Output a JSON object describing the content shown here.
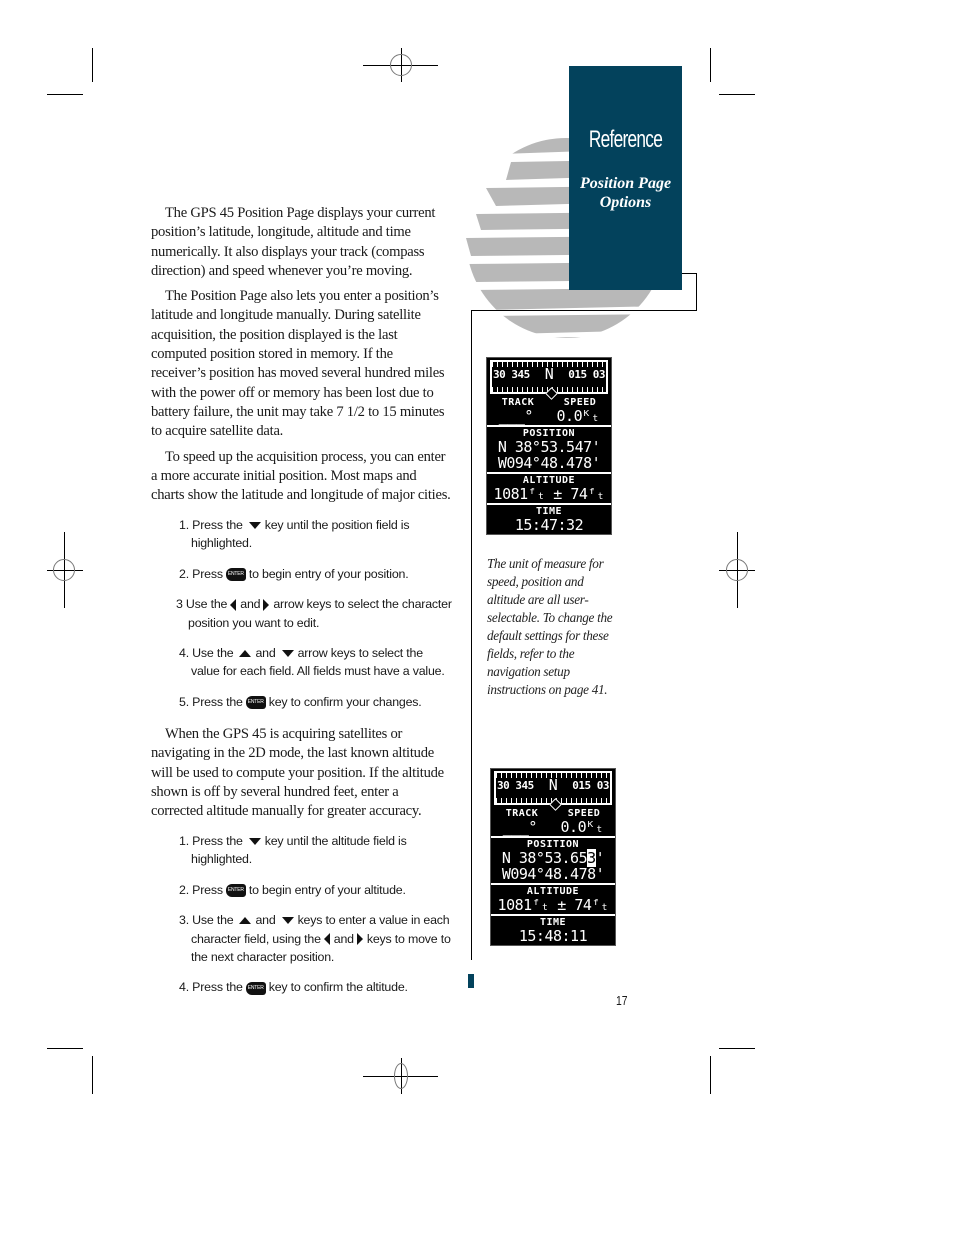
{
  "sidebar": {
    "section_title": "Reference",
    "subtitle_line1": "Position Page",
    "subtitle_line2": "Options",
    "accent_color": "#03425c"
  },
  "body": {
    "paragraphs_intro": [
      "The GPS 45 Position Page displays your current position’s latitude, longitude, altitude and time numerically. It also displays your track (compass direction) and speed whenever you’re moving.",
      "The Position Page also lets you enter a position’s latitude and longitude manually. During satellite acquisition, the position displayed is the last computed position stored in memory. If the receiver’s position has moved several hundred miles with the power off or memory has been lost due to battery failure, the unit may take 7 1/2 to 15 minutes to acquire satellite data.",
      "To speed up the acquisition process, you can enter a more accurate initial position. Most maps and charts show the latitude and longitude of major cities."
    ],
    "position_steps": {
      "s1": {
        "pre": "1. Press the",
        "post": "key until the position field is highlighted."
      },
      "s2": {
        "pre": "2. Press",
        "post": "to begin entry of your position."
      },
      "s3": {
        "pre": "3 Use the",
        "mid": "and",
        "post": "arrow keys to select the character position you want to edit."
      },
      "s4": {
        "pre": "4. Use the",
        "mid": "and",
        "post": "arrow keys to select the value for each field. All fields must have a value."
      },
      "s5": {
        "pre": "5. Press the",
        "post": "key to confirm your changes."
      }
    },
    "paragraph_altitude": "When the GPS 45 is acquiring satellites or navigating in the 2D mode, the last known altitude will be used to compute your position. If the altitude shown is off by several hundred feet, enter a corrected altitude manually for greater accuracy.",
    "altitude_steps": {
      "s1": {
        "pre": "1. Press the",
        "post": "key until the altitude field is highlighted."
      },
      "s2": {
        "pre": "2. Press",
        "post": "to begin entry of your altitude."
      },
      "s3": {
        "pre": "3. Use the",
        "mid": "and",
        "mid2": "keys to enter a value in each character field, using the",
        "mid3": "and",
        "post": "keys to move to the next character position."
      },
      "s4": {
        "pre": "4. Press the",
        "post": "key to confirm the altitude."
      }
    },
    "enter_key_label": "ENTER"
  },
  "caption": "The unit of measure for speed, position and altitude are all user-selectable. To change the default settings for these fields, refer to the navigation setup instructions on page 41.",
  "screens": [
    {
      "compass": {
        "left": "30 345",
        "center": "N",
        "right": "015 03"
      },
      "track_label": "TRACK",
      "speed_label": "SPEED",
      "track_value": "___°",
      "speed_value": "0.0ᴷₜ",
      "position_label": "POSITION",
      "lat": "N 38°53.547'",
      "lon": "W094°48.478'",
      "altitude_label": "ALTITUDE",
      "altitude_value": "1081ᶠₜ ± 74ᶠₜ",
      "time_label": "TIME",
      "time_value": "15:47:32"
    },
    {
      "compass": {
        "left": "30 345",
        "center": "N",
        "right": "015 03"
      },
      "track_label": "TRACK",
      "speed_label": "SPEED",
      "track_value": "___°",
      "speed_value": "0.0ᴷₜ",
      "position_label": "POSITION",
      "lat_prefix": "N 38°53.65",
      "lat_highlight": "3",
      "lat_suffix": "'",
      "lon": "W094°48.478'",
      "altitude_label": "ALTITUDE",
      "altitude_value": "1081ᶠₜ ± 74ᶠₜ",
      "time_label": "TIME",
      "time_value": "15:48:11"
    }
  ],
  "page_number": "17"
}
